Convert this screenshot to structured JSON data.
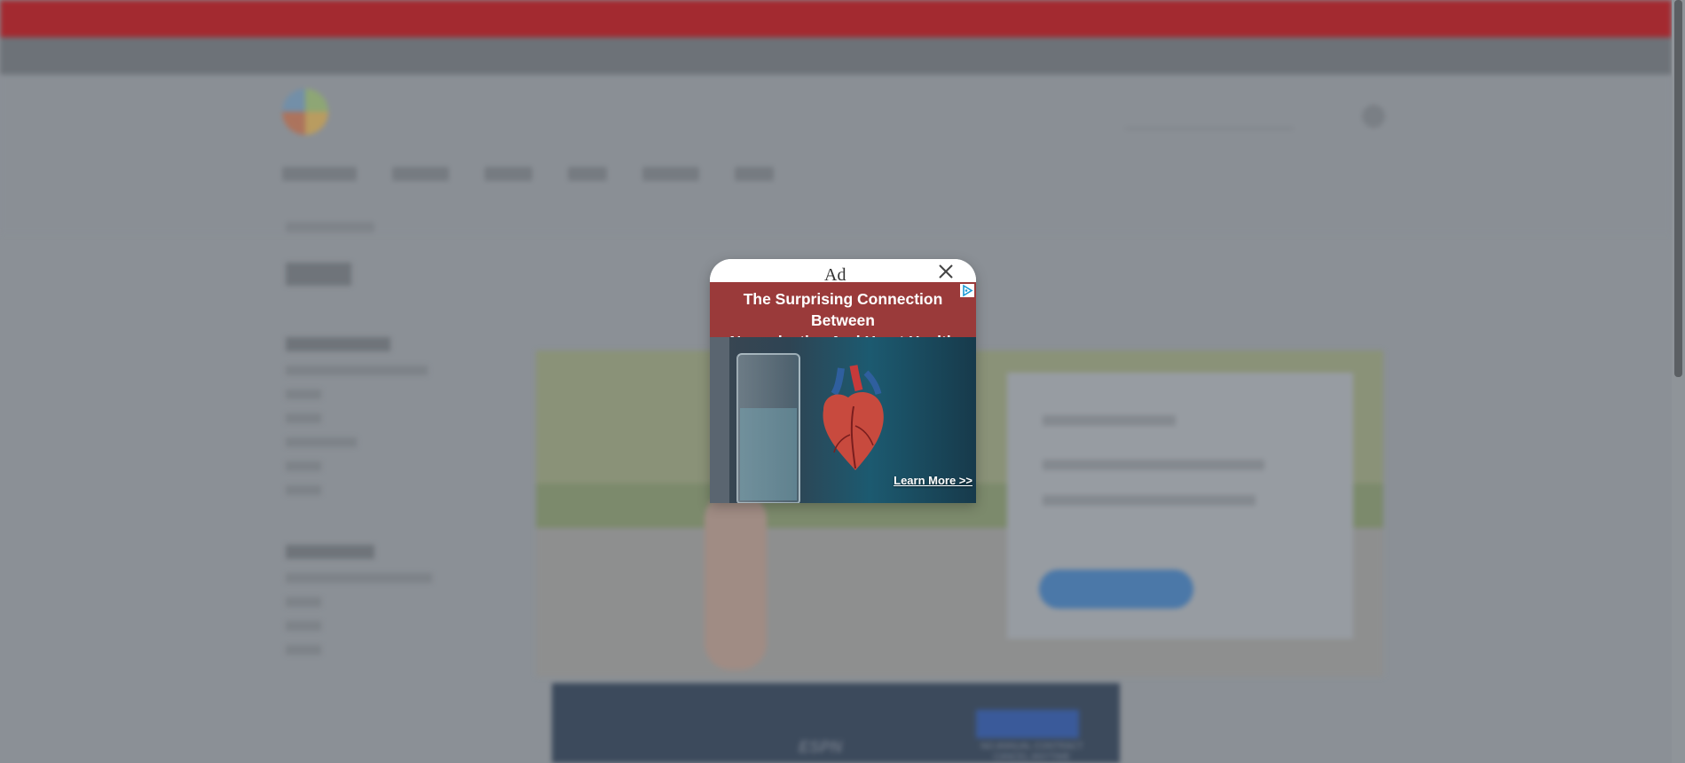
{
  "modal": {
    "ad_label": "Ad",
    "close_icon": "close-icon",
    "adchoices_icon": "adchoices-icon",
    "headline_line1": "The Surprising Connection Between",
    "headline_line2": "Nanoplastics And Heart Health",
    "cta": "Learn More >>"
  },
  "bottom_ad": {
    "brand": "ESPN",
    "tagline_line1": "NO ANNUAL CONTRACT",
    "tagline_line2": "CANCEL ANYTIME"
  },
  "colors": {
    "overlay_dim": "#8b9096",
    "promo_bar": "#a32a30",
    "ad_headline_band": "#9a3a3a",
    "ad_cta_text": "#ffffff"
  }
}
